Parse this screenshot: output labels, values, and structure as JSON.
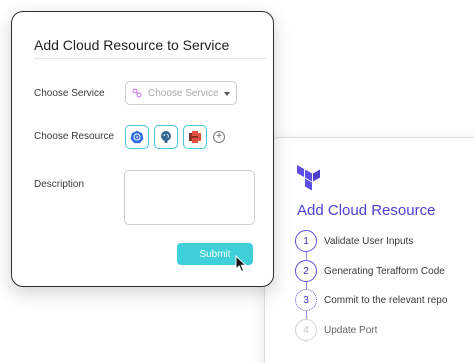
{
  "form": {
    "title": "Add Cloud Resource to Service",
    "service_label": "Choose Service",
    "service_placeholder": "Choose Service",
    "resource_label": "Choose Resource",
    "add_icon": "+",
    "description_label": "Description",
    "description_value": "",
    "submit_label": "Submit",
    "resources": [
      {
        "name": "kubernetes",
        "icon": "kubernetes-icon"
      },
      {
        "name": "postgresql",
        "icon": "postgresql-icon"
      },
      {
        "name": "aws-s3",
        "icon": "aws-s3-icon"
      }
    ]
  },
  "panel": {
    "logo": "terraform-logo",
    "title": "Add Cloud Resource",
    "steps": [
      {
        "num": "1",
        "label": "Validate User Inputs",
        "state": "done"
      },
      {
        "num": "2",
        "label": "Generating Terafform Code",
        "state": "done"
      },
      {
        "num": "3",
        "label": "Commit to the relevant repo",
        "state": "active"
      },
      {
        "num": "4",
        "label": "Update Port",
        "state": "pending"
      }
    ]
  },
  "colors": {
    "accent_teal": "#3fcfd9",
    "terraform_purple": "#5c4ee5",
    "step_purple": "#4a40d4"
  }
}
